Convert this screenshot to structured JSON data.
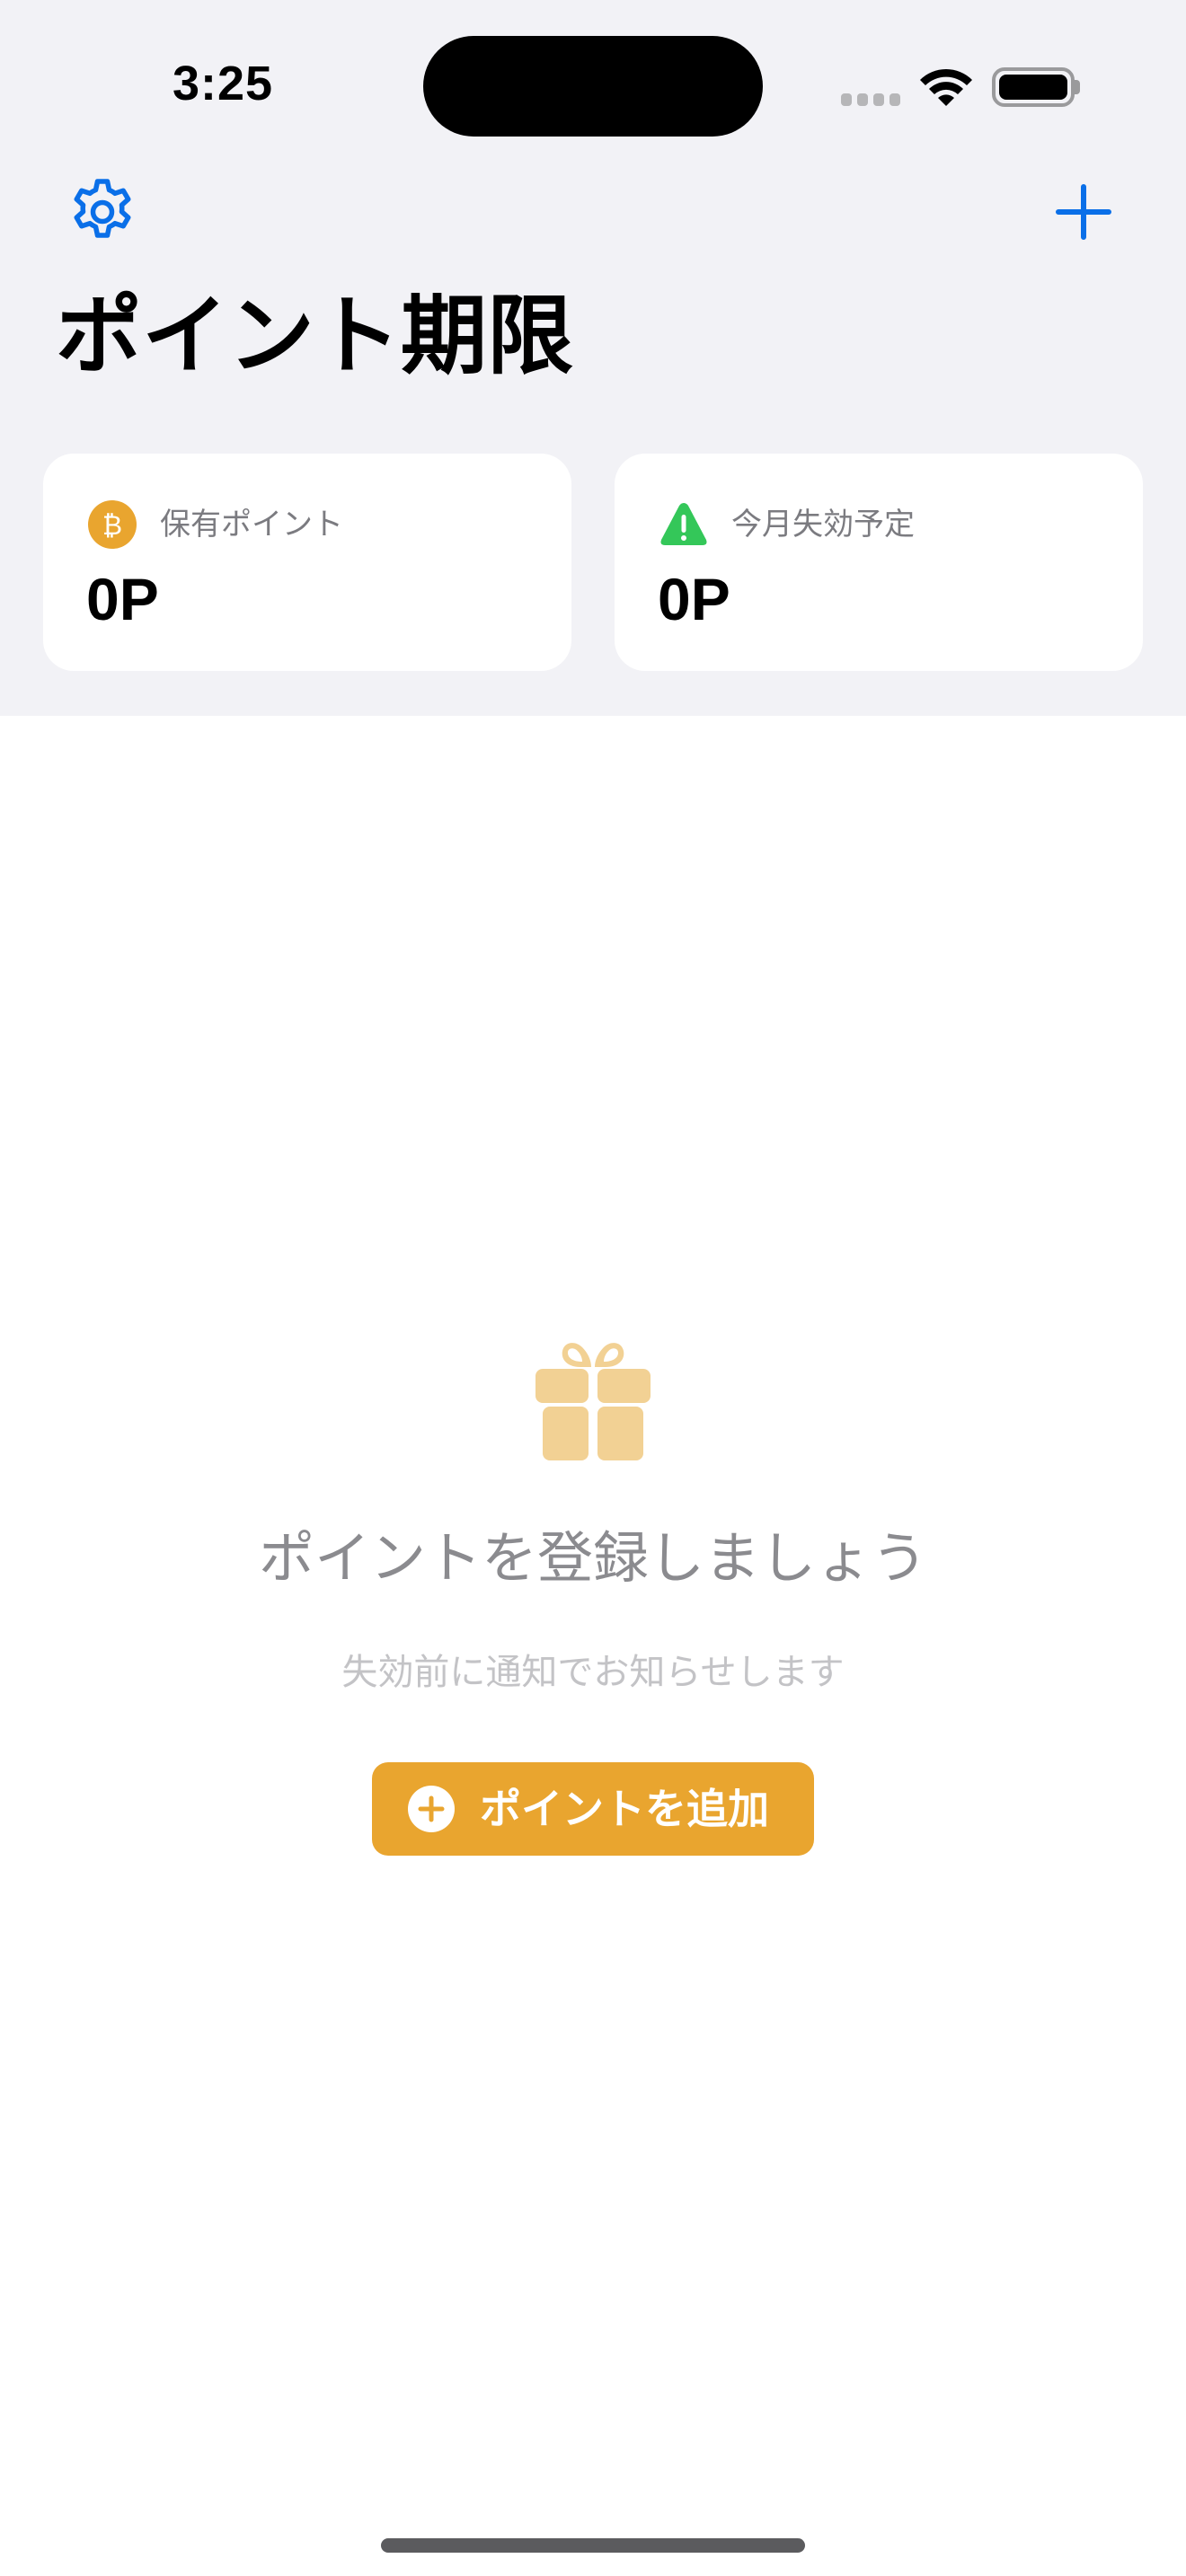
{
  "status_bar": {
    "time": "3:25",
    "icons": [
      "signal-icon",
      "wifi-icon",
      "battery-icon"
    ]
  },
  "nav": {
    "settings_icon": "gear-icon",
    "add_icon": "plus-icon",
    "title": "ポイント期限"
  },
  "summary": {
    "held": {
      "icon": "bitcoin-coin-icon",
      "label": "保有ポイント",
      "value": "0P"
    },
    "expiring": {
      "icon": "warning-triangle-icon",
      "label": "今月失効予定",
      "value": "0P"
    }
  },
  "empty_state": {
    "icon": "gift-icon",
    "title": "ポイントを登録しましょう",
    "subtitle": "失効前に通知でお知らせします",
    "button_label": "ポイントを追加",
    "button_icon": "plus-circle-icon"
  },
  "colors": {
    "accent_blue": "#0a6fe8",
    "accent_orange": "#e9a52f",
    "warning_green": "#34c759",
    "gift_tint": "#f2d194",
    "background": "#f2f2f6"
  }
}
